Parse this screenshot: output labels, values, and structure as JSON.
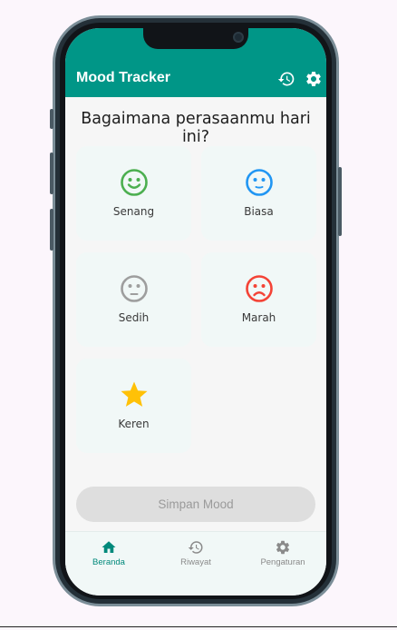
{
  "appbar": {
    "title": "Mood Tracker",
    "actions": [
      {
        "icon": "history-icon"
      },
      {
        "icon": "settings-icon"
      }
    ]
  },
  "question": "Bagaimana perasaanmu hari ini?",
  "moods": [
    {
      "label": "Senang",
      "icon": "happy-face-icon",
      "color": "#4caf50"
    },
    {
      "label": "Biasa",
      "icon": "neutral-face-icon",
      "color": "#2196f3"
    },
    {
      "label": "Sedih",
      "icon": "sad-face-icon",
      "color": "#9e9e9e"
    },
    {
      "label": "Marah",
      "icon": "angry-face-icon",
      "color": "#f44336"
    },
    {
      "label": "Keren",
      "icon": "star-icon",
      "color": "#ffc107"
    }
  ],
  "save_button": {
    "label": "Simpan Mood",
    "enabled": false
  },
  "bottom_nav": {
    "items": [
      {
        "label": "Beranda",
        "icon": "home-icon",
        "active": true
      },
      {
        "label": "Riwayat",
        "icon": "history-icon",
        "active": false
      },
      {
        "label": "Pengaturan",
        "icon": "settings-icon",
        "active": false
      }
    ]
  },
  "colors": {
    "primary": "#009687",
    "card_bg": "#f1f8f7",
    "active_nav": "#00897b",
    "inactive_nav": "#8a8a8a"
  }
}
